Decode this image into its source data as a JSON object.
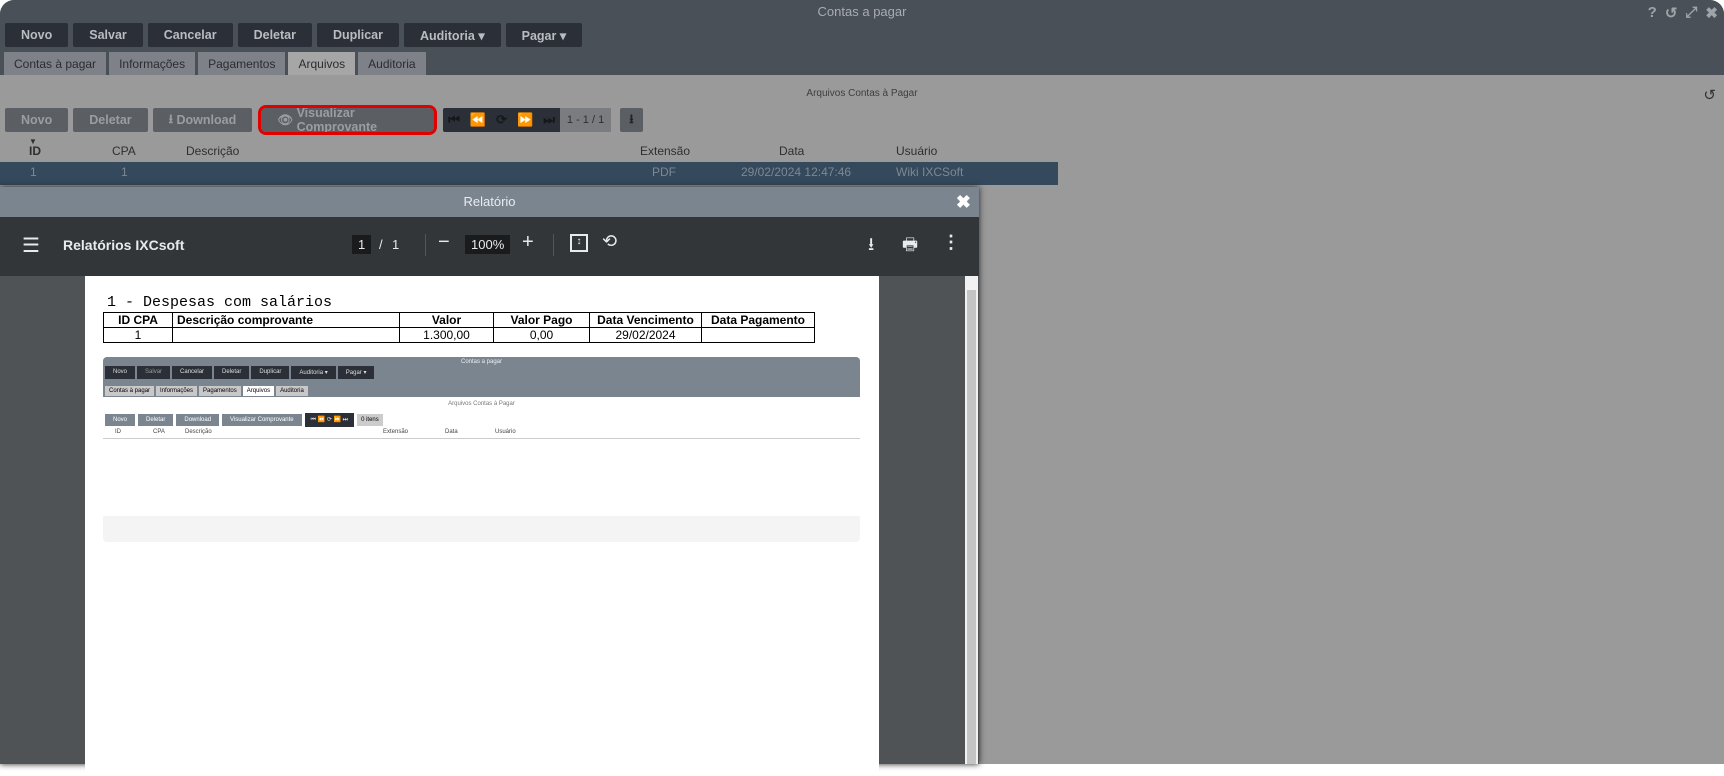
{
  "window": {
    "title": "Contas a pagar",
    "icons": [
      "help-icon",
      "history-icon",
      "expand-icon",
      "close-icon"
    ]
  },
  "toolbar": [
    "Novo",
    "Salvar",
    "Cancelar",
    "Deletar",
    "Duplicar",
    "Auditoria ▾",
    "Pagar ▾"
  ],
  "tabs": [
    {
      "label": "Contas à pagar"
    },
    {
      "label": "Informações"
    },
    {
      "label": "Pagamentos"
    },
    {
      "label": "Arquivos",
      "active": true
    },
    {
      "label": "Auditoria"
    }
  ],
  "section": {
    "title": "Arquivos Contas à Pagar",
    "buttons": {
      "novo": "Novo",
      "deletar": "Deletar",
      "download": "Download",
      "visualizar": "Visualizar Comprovante"
    },
    "pager": "1 - 1 / 1",
    "columns": [
      "ID",
      "CPA",
      "Descrição",
      "Extensão",
      "Data",
      "Usuário"
    ],
    "rows": [
      {
        "id": "1",
        "cpa": "1",
        "descricao": "",
        "extensao": "PDF",
        "data": "29/02/2024 12:47:46",
        "usuario": "Wiki IXCSoft"
      }
    ]
  },
  "modal": {
    "title": "Relatório",
    "pdf_title": "Relatórios IXCsoft",
    "page": "1",
    "pages": "1",
    "zoom": "100%",
    "report": {
      "heading": "1 - Despesas com salários",
      "columns": [
        "ID CPA",
        "Descrição comprovante",
        "Valor",
        "Valor Pago",
        "Data Vencimento",
        "Data Pagamento"
      ],
      "rows": [
        [
          "1",
          "",
          "1.300,00",
          "0,00",
          "29/02/2024",
          ""
        ]
      ]
    },
    "mini": {
      "title": "Contas a pagar",
      "toolbar": [
        "Novo",
        "Salvar",
        "Cancelar",
        "Deletar",
        "Duplicar",
        "Auditoria ▾",
        "Pagar ▾"
      ],
      "tabs": [
        "Contas à pagar",
        "Informações",
        "Pagamentos",
        "Arquivos",
        "Auditoria"
      ],
      "subtitle": "Arquivos Contas à Pagar",
      "buttons": [
        "Novo",
        "Deletar",
        "Download",
        "Visualizar Comprovante"
      ],
      "pager": "0 itens",
      "columns": [
        "ID",
        "CPA",
        "Descrição",
        "Extensão",
        "Data",
        "Usuário"
      ]
    }
  },
  "colors": {
    "highlight": "#e00000",
    "selected_row": "#34495c"
  }
}
